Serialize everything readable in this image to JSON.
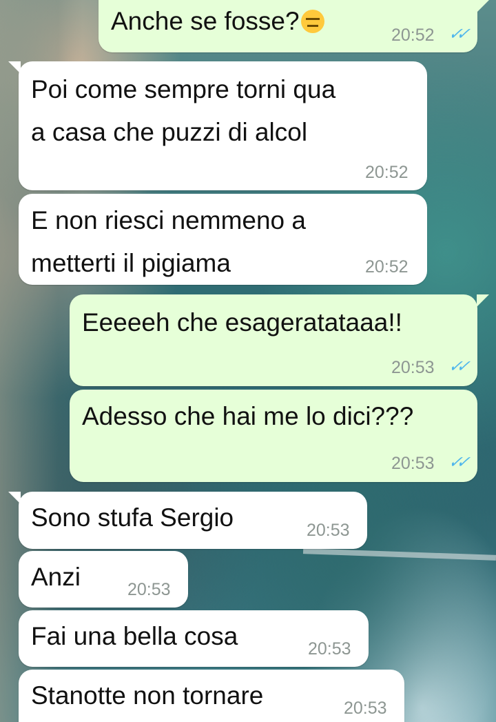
{
  "messages": [
    {
      "direction": "out",
      "text": "Anche se fosse?",
      "emoji": "expressionless-face",
      "time": "20:52",
      "status": "read"
    },
    {
      "direction": "in",
      "text": "Poi come sempre torni qua\na casa che puzzi di alcol",
      "time": "20:52"
    },
    {
      "direction": "in",
      "text": "E non riesci nemmeno a\nmetterti il pigiama",
      "time": "20:52"
    },
    {
      "direction": "out",
      "text": "Eeeeeh che esageratataaa!!",
      "time": "20:53",
      "status": "read"
    },
    {
      "direction": "out",
      "text": "Adesso che hai me lo dici???",
      "time": "20:53",
      "status": "read"
    },
    {
      "direction": "in",
      "text": "Sono stufa Sergio",
      "time": "20:53"
    },
    {
      "direction": "in",
      "text": "Anzi",
      "time": "20:53"
    },
    {
      "direction": "in",
      "text": "Fai una bella cosa",
      "time": "20:53"
    },
    {
      "direction": "in",
      "text": "Stanotte non tornare",
      "time": "20:53"
    }
  ],
  "colors": {
    "outgoing_bubble": "#e6ffd8",
    "incoming_bubble": "#ffffff",
    "read_ticks": "#4fb6ec",
    "timestamp": "#8d9692"
  },
  "icons": {
    "read_receipt": "double-check-icon",
    "emoji": "expressionless-face-emoji"
  }
}
